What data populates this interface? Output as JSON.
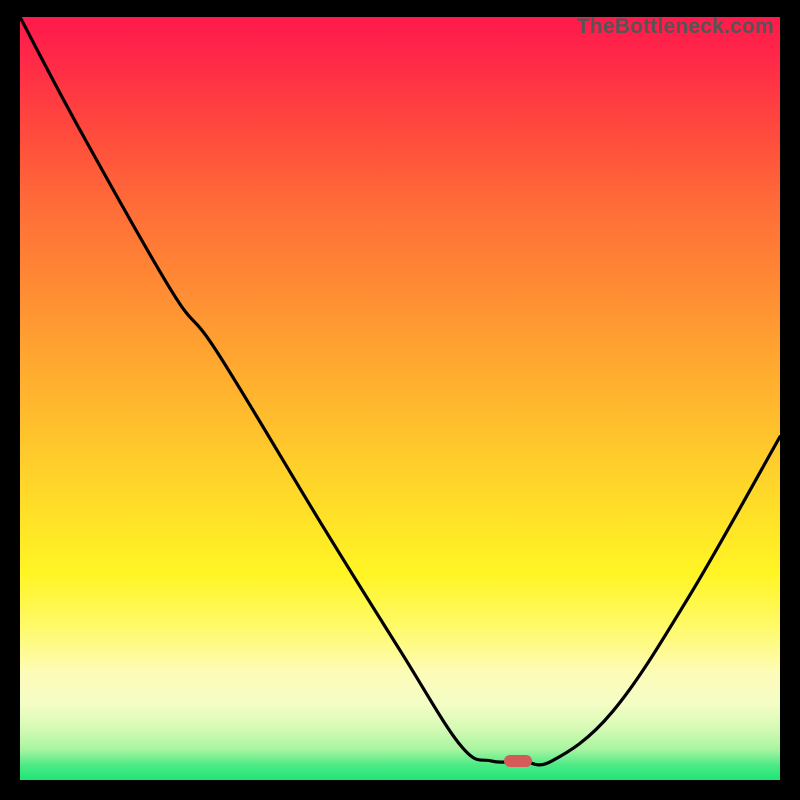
{
  "watermark": "TheBottleneck.com",
  "marker": {
    "cx_pct": 65.5,
    "cy_pct": 97.5
  },
  "chart_data": {
    "type": "line",
    "title": "",
    "xlabel": "",
    "ylabel": "",
    "xlim": [
      0,
      100
    ],
    "ylim": [
      0,
      100
    ],
    "grid": false,
    "series": [
      {
        "name": "curve",
        "x": [
          0,
          8,
          20,
          26,
          40,
          50,
          58,
          62,
          66,
          70,
          78,
          88,
          100
        ],
        "values": [
          100,
          85,
          64,
          56,
          33,
          17,
          4.5,
          2.5,
          2.5,
          2.5,
          9,
          24,
          45
        ]
      }
    ],
    "annotations": [
      {
        "type": "marker",
        "x": 65.5,
        "y": 2.5,
        "shape": "pill",
        "color": "#d65a5a"
      }
    ]
  }
}
